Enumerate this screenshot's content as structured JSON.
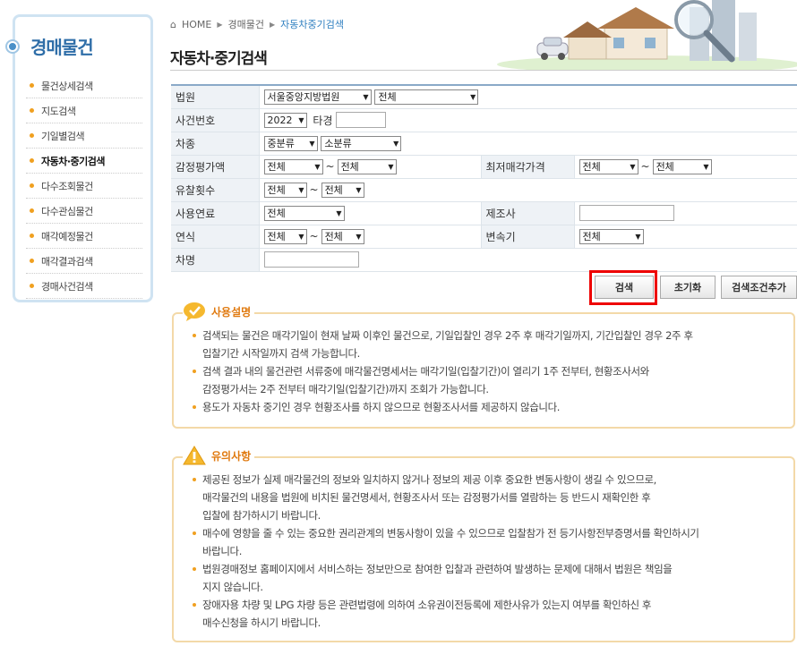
{
  "sidebar": {
    "title": "경매물건",
    "items": [
      {
        "label": "물건상세검색"
      },
      {
        "label": "지도검색"
      },
      {
        "label": "기일별검색"
      },
      {
        "label": "자동차·중기검색"
      },
      {
        "label": "다수조회물건"
      },
      {
        "label": "다수관심물건"
      },
      {
        "label": "매각예정물건"
      },
      {
        "label": "매각결과검색"
      },
      {
        "label": "경매사건검색"
      }
    ],
    "active_index": 3
  },
  "breadcrumb": {
    "home": "HOME",
    "level1": "경매물건",
    "current": "자동차중기검색"
  },
  "page_title": "자동차·중기검색",
  "form": {
    "court": {
      "label": "법원",
      "court_value": "서울중앙지방법원",
      "branch_value": "전체"
    },
    "case_no": {
      "label": "사건번호",
      "year_value": "2022",
      "type_label": "타경"
    },
    "vehicle_type": {
      "label": "차종",
      "major_value": "중분류",
      "minor_value": "소분류"
    },
    "appraisal": {
      "label": "감정평가액",
      "from_value": "전체",
      "to_value": "전체",
      "tilde": "~"
    },
    "min_price": {
      "label": "최저매각가격",
      "from_value": "전체",
      "to_value": "전체",
      "tilde": "~"
    },
    "failed_count": {
      "label": "유찰횟수",
      "from_value": "전체",
      "to_value": "전체",
      "tilde": "~"
    },
    "fuel": {
      "label": "사용연료",
      "value": "전체"
    },
    "maker": {
      "label": "제조사"
    },
    "model_year": {
      "label": "연식",
      "from_value": "전체",
      "to_value": "전체",
      "tilde": "~"
    },
    "transmission": {
      "label": "변속기",
      "value": "전체"
    },
    "car_name": {
      "label": "차명"
    }
  },
  "buttons": {
    "search": "검색",
    "reset": "초기화",
    "add_condition": "검색조건추가"
  },
  "usage_box": {
    "title": "사용설명",
    "items": [
      [
        "검색되는 물건은 매각기일이 현재 날짜 이후인 물건으로, 기일입찰인 경우 2주 후 매각기일까지, 기간입찰인 경우 2주 후",
        "입찰기간 시작일까지 검색 가능합니다."
      ],
      [
        "검색 결과 내의 물건관련 서류중에 매각물건명세서는 매각기일(입찰기간)이 열리기 1주 전부터, 현황조사서와",
        "감정평가서는 2주 전부터 매각기일(입찰기간)까지 조회가 가능합니다."
      ],
      [
        "용도가 자동차 중기인 경우 현황조사를 하지 않으므로 현황조사서를 제공하지 않습니다."
      ]
    ]
  },
  "caution_box": {
    "title": "유의사항",
    "items": [
      [
        "제공된 정보가 실제 매각물건의 정보와 일치하지 않거나 정보의 제공 이후 중요한 변동사항이 생길 수 있으므로,",
        "매각물건의 내용을 법원에 비치된 물건명세서, 현황조사서 또는 감정평가서를 열람하는 등 반드시 재확인한 후",
        "입찰에 참가하시기 바랍니다."
      ],
      [
        "매수에 영향을 줄 수 있는 중요한 권리관계의 변동사항이 있을 수 있으므로 입찰참가 전 등기사항전부증명서를 확인하시기",
        "바랍니다."
      ],
      [
        "법원경매정보 홈페이지에서 서비스하는 정보만으로 참여한 입찰과 관련하여 발생하는 문제에 대해서 법원은 책임을",
        "지지 않습니다."
      ],
      [
        "장애자용 차량 및 LPG 차량 등은 관련법령에 의하여 소유권이전등록에 제한사유가 있는지 여부를 확인하신 후",
        "매수신청을 하시기 바랍니다."
      ]
    ]
  },
  "colors": {
    "accent_blue": "#2f6ea8",
    "accent_orange": "#e07a10",
    "highlight_red": "#e00000"
  }
}
